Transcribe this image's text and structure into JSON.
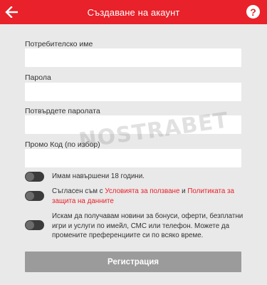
{
  "header": {
    "title": "Създаване на акаунт",
    "back_icon": "arrow-left-icon",
    "help_icon": "help-circle-icon",
    "help_glyph": "?",
    "accent_color": "#e8212a"
  },
  "form": {
    "username_label": "Потребителско име",
    "username_value": "",
    "password_label": "Парола",
    "password_value": "",
    "confirm_label": "Потвърдете паролата",
    "confirm_value": "",
    "promo_label": "Промо Код (по избор)",
    "promo_value": ""
  },
  "watermark": "NOSTRABET",
  "consents": {
    "age_text": "Имам навършени 18 години.",
    "terms_prefix": "Съгласен съм с ",
    "terms_link": "Условията за ползване",
    "terms_and": " и ",
    "privacy_link": "Политиката за защита на данните",
    "marketing_text": "Искам да получавам новини за бонуси, оферти, безплатни игри и услуги по имейл, СМС или телефон. Можете да промените преференциите си по всяко време."
  },
  "submit_label": "Регистрация"
}
